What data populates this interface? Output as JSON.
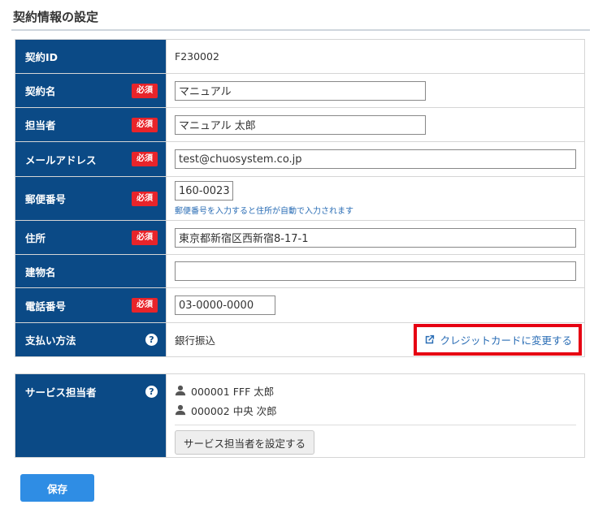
{
  "page": {
    "title": "契約情報の設定"
  },
  "badge": {
    "required": "必須"
  },
  "form": {
    "contract_id": {
      "label": "契約ID",
      "value": "F230002"
    },
    "contract_name": {
      "label": "契約名",
      "value": "マニュアル"
    },
    "person_in_charge": {
      "label": "担当者",
      "value": "マニュアル 太郎"
    },
    "email": {
      "label": "メールアドレス",
      "value": "test@chuosystem.co.jp"
    },
    "postal_code": {
      "label": "郵便番号",
      "value": "160-0023",
      "hint": "郵便番号を入力すると住所が自動で入力されます"
    },
    "address": {
      "label": "住所",
      "value": "東京都新宿区西新宿8-17-1"
    },
    "building": {
      "label": "建物名",
      "value": ""
    },
    "phone": {
      "label": "電話番号",
      "value": "03-0000-0000"
    },
    "payment": {
      "label": "支払い方法",
      "value": "銀行振込",
      "change_link": "クレジットカードに変更する"
    }
  },
  "service_staff": {
    "label": "サービス担当者",
    "members": [
      {
        "text": "000001 FFF 太郎"
      },
      {
        "text": "000002 中央 次郎"
      }
    ],
    "set_button": "サービス担当者を設定する"
  },
  "actions": {
    "save": "保存"
  },
  "colors": {
    "header_bg": "#0b4a86",
    "required_red": "#e8242a",
    "link_blue": "#2a6db5",
    "save_blue": "#2f8de4",
    "highlight_red": "#e60012"
  }
}
